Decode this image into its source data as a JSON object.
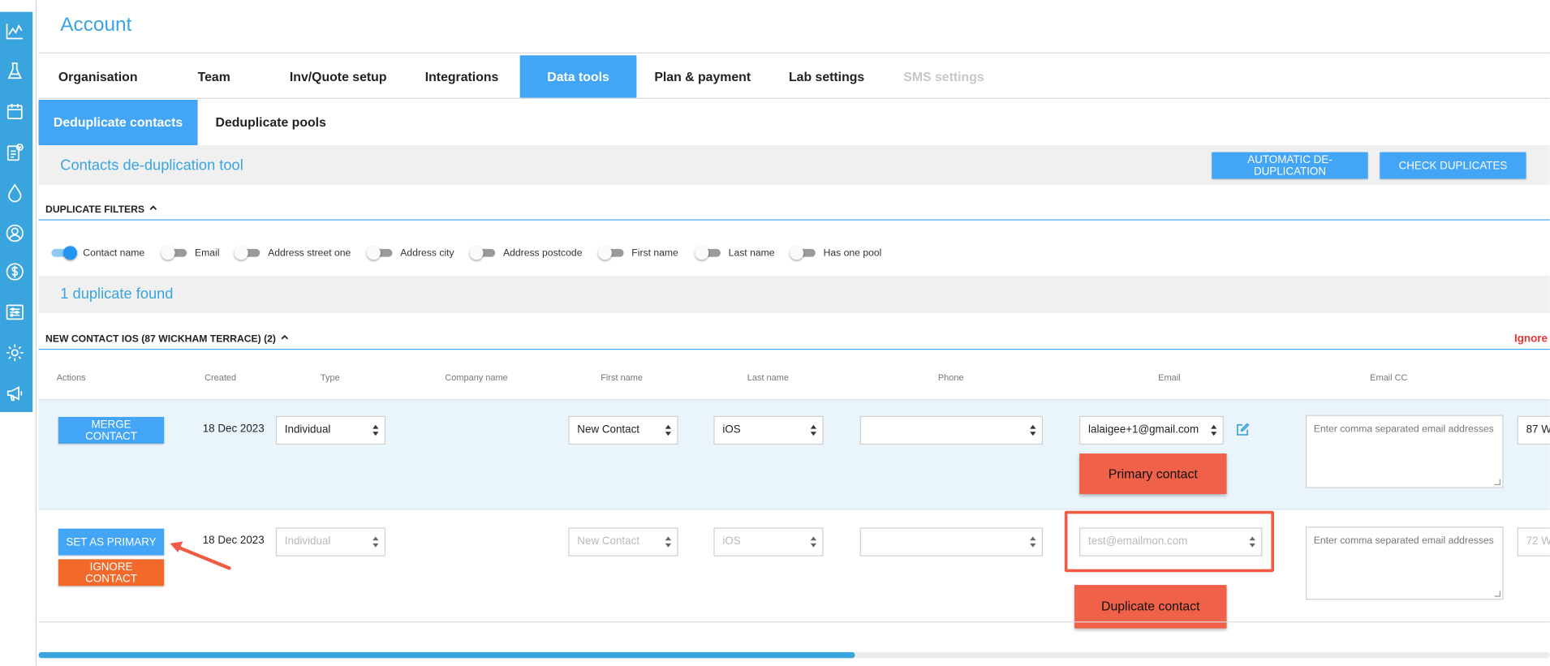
{
  "page": {
    "title": "Account"
  },
  "tabs": [
    {
      "label": "Organisation"
    },
    {
      "label": "Team"
    },
    {
      "label": "Inv/Quote setup"
    },
    {
      "label": "Integrations"
    },
    {
      "label": "Data tools",
      "active": true
    },
    {
      "label": "Plan & payment"
    },
    {
      "label": "Lab settings"
    },
    {
      "label": "SMS settings",
      "disabled": true
    }
  ],
  "subtabs": [
    {
      "label": "Deduplicate contacts",
      "active": true
    },
    {
      "label": "Deduplicate pools"
    }
  ],
  "tool": {
    "title": "Contacts de-duplication tool",
    "auto_button": "AUTOMATIC DE-DUPLICATION",
    "check_button": "CHECK DUPLICATES"
  },
  "filters": {
    "heading": "DUPLICATE FILTERS",
    "items": [
      {
        "label": "Contact name",
        "on": true
      },
      {
        "label": "Email",
        "on": false
      },
      {
        "label": "Address street one",
        "on": false
      },
      {
        "label": "Address city",
        "on": false
      },
      {
        "label": "Address postcode",
        "on": false
      },
      {
        "label": "First name",
        "on": false
      },
      {
        "label": "Last name",
        "on": false
      },
      {
        "label": "Has one pool",
        "on": false
      }
    ]
  },
  "results": {
    "found_text": "1 duplicate found"
  },
  "group": {
    "heading": "NEW CONTACT IOS (87 WICKHAM TERRACE) (2)",
    "ignore_label": "Ignore"
  },
  "columns": [
    "Actions",
    "Created",
    "Type",
    "Company name",
    "First name",
    "Last name",
    "Phone",
    "Email",
    "Email CC"
  ],
  "rows": [
    {
      "action": "MERGE CONTACT",
      "created": "18 Dec 2023",
      "type": "Individual",
      "first_name": "New Contact",
      "last_name": "iOS",
      "phone": "",
      "email": "lalaigee+1@gmail.com",
      "email_cc_placeholder": "Enter comma separated email addresses",
      "address": "87 W"
    },
    {
      "action_primary": "SET AS PRIMARY",
      "action_ignore": "IGNORE CONTACT",
      "created": "18 Dec 2023",
      "type": "Individual",
      "first_name": "New Contact",
      "last_name": "iOS",
      "phone": "",
      "email": "test@emailmon.com",
      "email_cc_placeholder": "Enter comma separated email addresses",
      "address": "72 W"
    }
  ],
  "annotations": {
    "primary": "Primary contact",
    "duplicate": "Duplicate contact"
  },
  "colors": {
    "accent": "#42a5f5",
    "orange": "#f26a2b",
    "callout": "#f0614a"
  },
  "scroll": {
    "position_fraction": 0.54
  }
}
